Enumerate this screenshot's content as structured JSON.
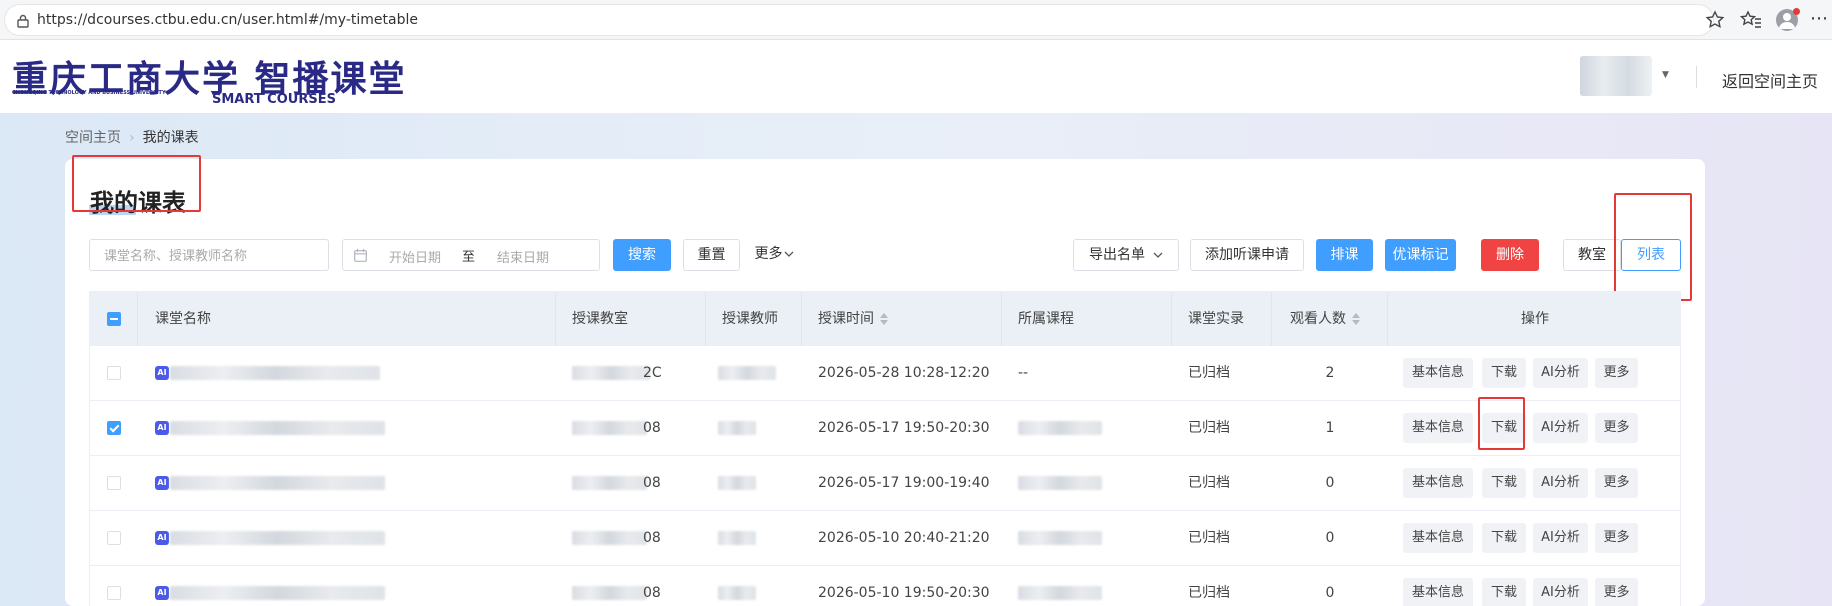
{
  "browser": {
    "url": "https://dcourses.ctbu.edu.cn/user.html#/my-timetable"
  },
  "header": {
    "logo_cn": "重庆工商大学 智播课堂",
    "logo_en_left": "CHONGQING TECHNOLOGY AND BUSINESS UNIVERSITY",
    "logo_en_right": "SMART COURSES",
    "back_link": "返回空间主页"
  },
  "breadcrumb": {
    "home": "空间主页",
    "separator": "›",
    "current": "我的课表"
  },
  "page": {
    "title": "我的课表"
  },
  "filters": {
    "search_placeholder": "课堂名称、授课教师名称",
    "date_start_placeholder": "开始日期",
    "date_separator": "至",
    "date_end_placeholder": "结束日期",
    "search_button": "搜索",
    "reset_button": "重置",
    "more_button": "更多",
    "export_button": "导出名单",
    "audit_button": "添加听课申请",
    "schedule_button": "排课",
    "mark_button": "优课标记",
    "delete_button": "删除",
    "view_classroom": "教室",
    "view_list": "列表"
  },
  "table": {
    "headers": {
      "name": "课堂名称",
      "room": "授课教室",
      "teacher": "授课教师",
      "time": "授课时间",
      "course": "所属课程",
      "record": "课堂实录",
      "viewers": "观看人数",
      "ops": "操作"
    },
    "ai_badge": "AI",
    "rows": [
      {
        "room_suffix": "2C",
        "time": "2026-05-28 10:28-12:20",
        "course": "--",
        "record": "已归档",
        "viewers": "2",
        "checked": false
      },
      {
        "room_suffix": "08",
        "time": "2026-05-17 19:50-20:30",
        "course": "",
        "record": "已归档",
        "viewers": "1",
        "checked": true
      },
      {
        "room_suffix": "08",
        "time": "2026-05-17 19:00-19:40",
        "course": "",
        "record": "已归档",
        "viewers": "0",
        "checked": false
      },
      {
        "room_suffix": "08",
        "time": "2026-05-10 20:40-21:20",
        "course": "",
        "record": "已归档",
        "viewers": "0",
        "checked": false
      },
      {
        "room_suffix": "08",
        "time": "2026-05-10 19:50-20:30",
        "course": "",
        "record": "已归档",
        "viewers": "0",
        "checked": false
      }
    ],
    "op_labels": {
      "info": "基本信息",
      "download": "下载",
      "ai": "AI分析",
      "more": "更多"
    }
  },
  "colors": {
    "primary": "#409eff",
    "danger": "#f04444",
    "annotation": "#e53935",
    "brand": "#2a2a86"
  }
}
